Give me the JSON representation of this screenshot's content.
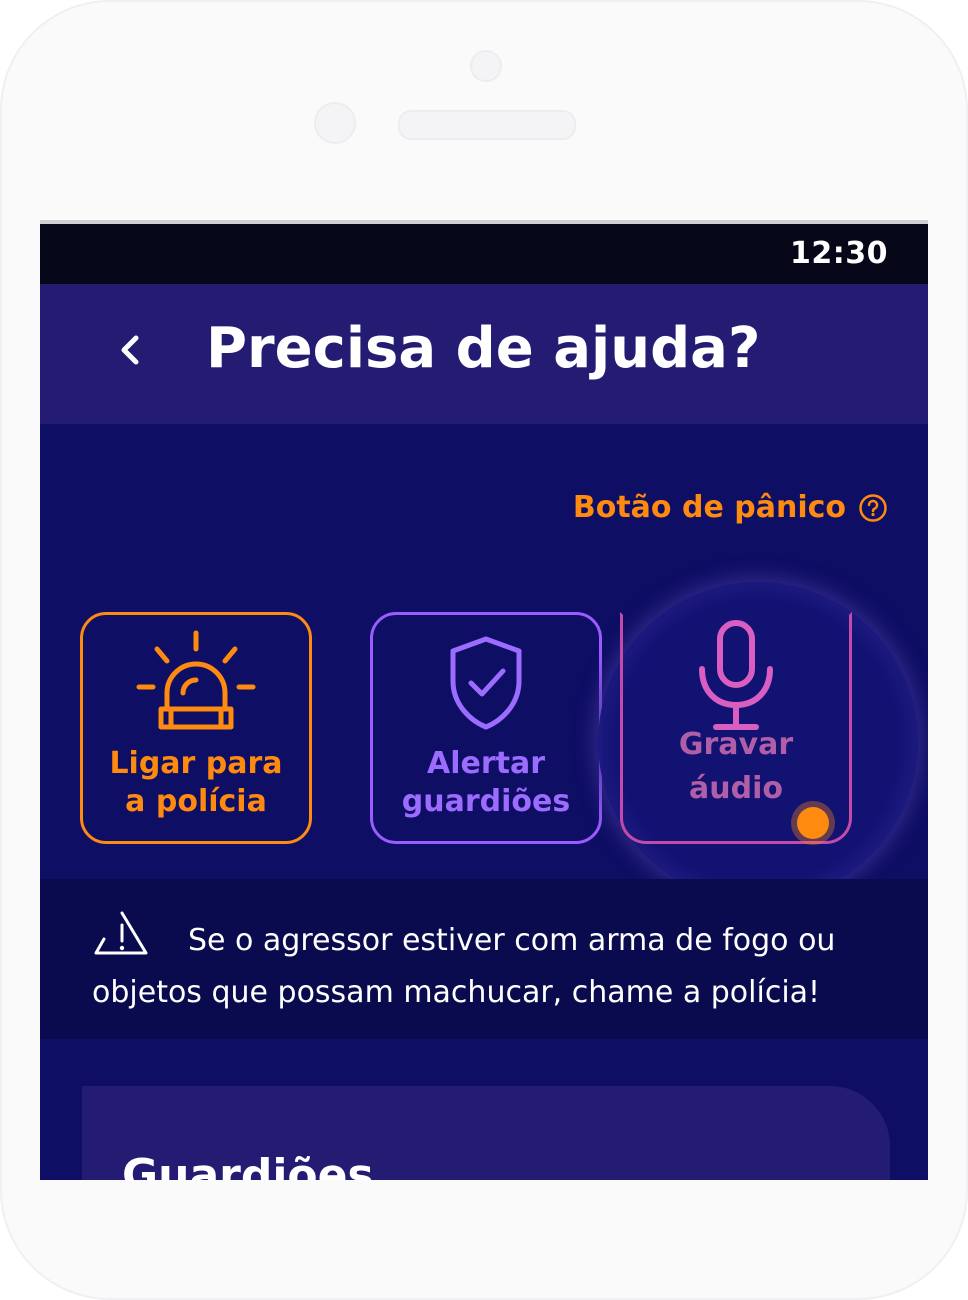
{
  "status_bar": {
    "time": "12:30"
  },
  "header": {
    "title": "Precisa de ajuda?",
    "back_icon": "chevron-left-icon"
  },
  "panic": {
    "label": "Botão de pânico",
    "help_icon": "question-circle-icon"
  },
  "actions": [
    {
      "label_line1": "Ligar para",
      "label_line2": "a polícia",
      "icon": "siren-icon",
      "color": "#ff8a10"
    },
    {
      "label_line1": "Alertar",
      "label_line2": "guardiões",
      "icon": "shield-check-icon",
      "color": "#9b6cff"
    },
    {
      "label_line1": "Gravar",
      "label_line2": "áudio",
      "icon": "microphone-icon",
      "color": "#c24aa8"
    }
  ],
  "warning": {
    "text": "Se o agressor estiver com arma de fogo ou objetos que possam machucar, chame a polícia!",
    "icon": "warning-triangle-icon"
  },
  "guardians": {
    "title": "Guardiões"
  },
  "colors": {
    "background": "#0e0e64",
    "header": "#231c72",
    "accent_orange": "#ff8a10",
    "accent_purple": "#9b6cff",
    "accent_pink": "#c24aa8"
  }
}
